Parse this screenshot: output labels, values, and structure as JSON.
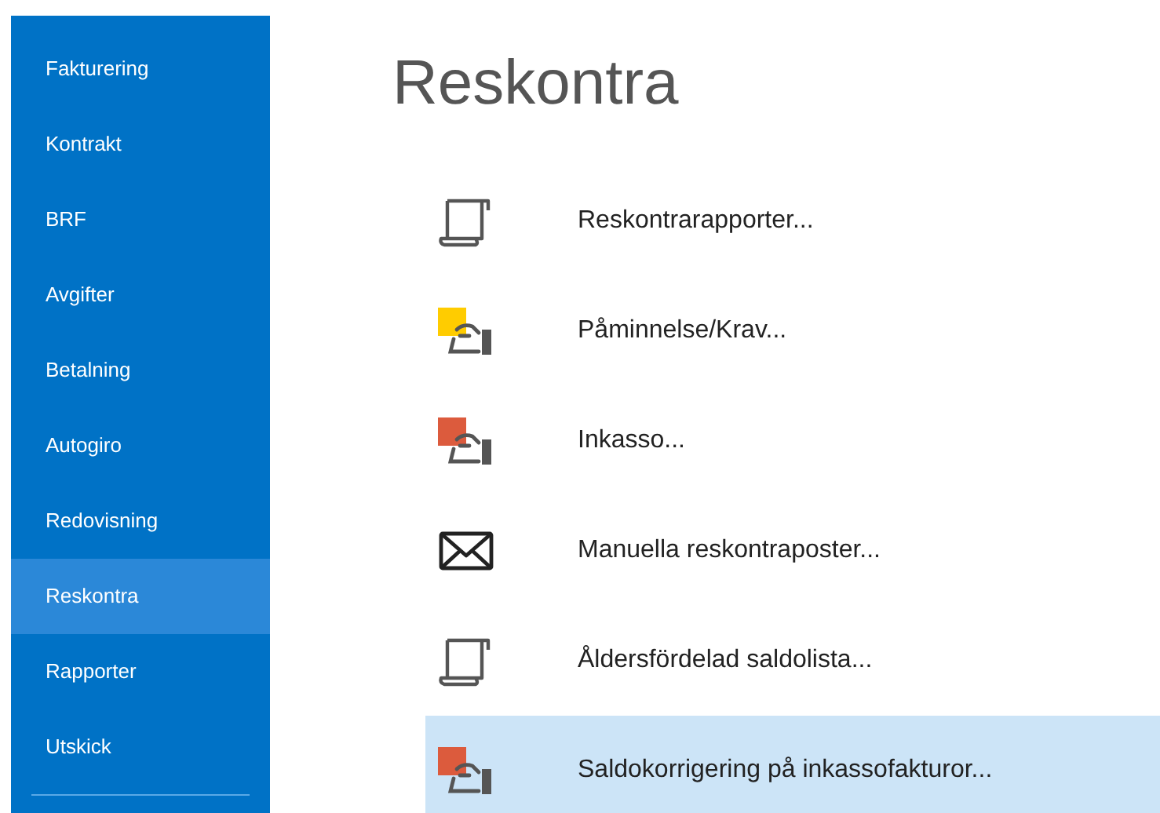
{
  "sidebar": {
    "items": [
      {
        "label": "Fakturering",
        "selected": false
      },
      {
        "label": "Kontrakt",
        "selected": false
      },
      {
        "label": "BRF",
        "selected": false
      },
      {
        "label": "Avgifter",
        "selected": false
      },
      {
        "label": "Betalning",
        "selected": false
      },
      {
        "label": "Autogiro",
        "selected": false
      },
      {
        "label": "Redovisning",
        "selected": false
      },
      {
        "label": "Reskontra",
        "selected": true
      },
      {
        "label": "Rapporter",
        "selected": false
      },
      {
        "label": "Utskick",
        "selected": false
      }
    ]
  },
  "page": {
    "title": "Reskontra",
    "actions": [
      {
        "label": "Reskontrarapporter...",
        "kind": "scroll",
        "selected": false
      },
      {
        "label": "Påminnelse/Krav...",
        "kind": "card",
        "color": "#ffcc00",
        "selected": false
      },
      {
        "label": "Inkasso...",
        "kind": "card",
        "color": "#dc5b3d",
        "selected": false
      },
      {
        "label": "Manuella reskontraposter...",
        "kind": "envelope",
        "selected": false
      },
      {
        "label": "Åldersfördelad saldolista...",
        "kind": "scroll",
        "selected": false
      },
      {
        "label": "Saldokorrigering på inkassofakturor...",
        "kind": "card",
        "color": "#dc5b3d",
        "selected": true
      }
    ]
  }
}
